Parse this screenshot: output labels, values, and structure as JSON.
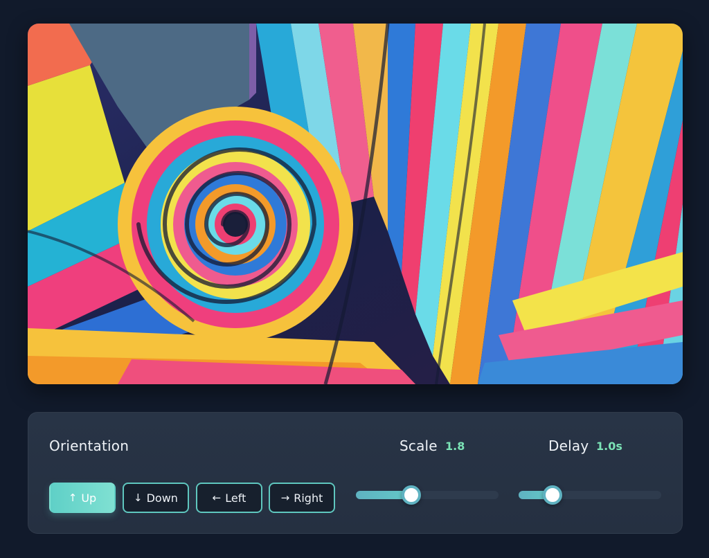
{
  "image": {
    "icon": "abstract-swirl-artwork"
  },
  "controls": {
    "orientation": {
      "label": "Orientation",
      "selected": "Up",
      "buttons": [
        {
          "arrow": "↑",
          "label": "Up"
        },
        {
          "arrow": "↓",
          "label": "Down"
        },
        {
          "arrow": "←",
          "label": "Left"
        },
        {
          "arrow": "→",
          "label": "Right"
        }
      ]
    },
    "scale": {
      "label": "Scale",
      "value_text": "1.8",
      "fill_fraction": 0.39
    },
    "delay": {
      "label": "Delay",
      "value_text": "1.0s",
      "fill_fraction": 0.24
    }
  },
  "colors": {
    "background": "#111a2b",
    "panel": "#283446",
    "accent": "#5fd0c7",
    "value_green": "#7be3b6"
  }
}
